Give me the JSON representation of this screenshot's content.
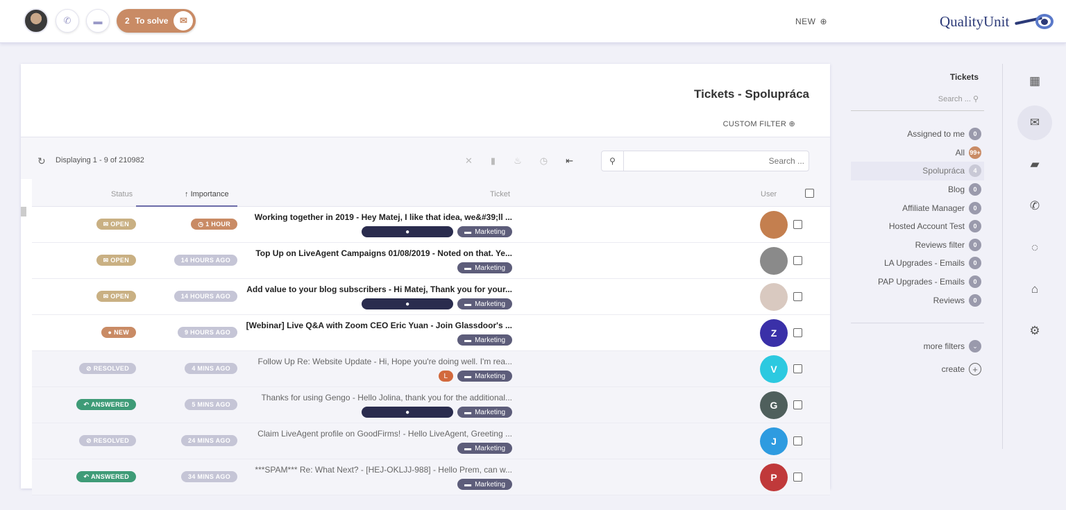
{
  "header": {
    "to_solve_label": "To solve",
    "to_solve_count": "2",
    "new_label": "NEW",
    "logo_text": "QualityUnit"
  },
  "main": {
    "title": "Tickets - Spolupráca",
    "custom_filter": "CUSTOM FILTER",
    "displaying": "Displaying 1 - 9 of 210982",
    "search_placeholder": "Search ...",
    "columns": {
      "user": "User",
      "ticket": "Ticket",
      "importance": "Importance",
      "status": "Status"
    },
    "rows": [
      {
        "subject": "Working together in 2019 - Hey Matej, I like that idea, we&#39;ll ...",
        "tags": [
          "Marketing"
        ],
        "dark_tag": true,
        "importance": "1 HOUR",
        "status": "OPEN",
        "read": false,
        "avatar_letter": "",
        "avatar_color": "#c47f4f"
      },
      {
        "subject": "Top Up on LiveAgent Campaigns 01/08/2019 - Noted on that. Ye...",
        "tags": [
          "Marketing"
        ],
        "dark_tag": false,
        "importance": "14 HOURS AGO",
        "status": "OPEN",
        "read": false,
        "avatar_letter": "",
        "avatar_color": "#8a8a8a"
      },
      {
        "subject": "Add value to your blog subscribers - Hi Matej, Thank you for your...",
        "tags": [
          "Marketing"
        ],
        "dark_tag": true,
        "importance": "14 HOURS AGO",
        "status": "OPEN",
        "read": false,
        "avatar_letter": "",
        "avatar_color": "#d9c9c0"
      },
      {
        "subject": "[Webinar] Live Q&A with Zoom CEO Eric Yuan - Join Glassdoor's ...",
        "tags": [
          "Marketing"
        ],
        "dark_tag": false,
        "importance": "9 HOURS AGO",
        "status": "NEW",
        "read": false,
        "avatar_letter": "Z",
        "avatar_color": "#3a30a8"
      },
      {
        "subject": "Follow Up Re: Website Update - Hi, Hope you're doing well. I'm rea...",
        "tags": [
          "Marketing"
        ],
        "dark_tag": false,
        "orange_tag": "L",
        "importance": "4 MINS AGO",
        "status": "RESOLVED",
        "read": true,
        "avatar_letter": "V",
        "avatar_color": "#2cc9e0"
      },
      {
        "subject": "Thanks for using Gengo - Hello Jolina, thank you for the additional...",
        "tags": [
          "Marketing"
        ],
        "dark_tag": true,
        "importance": "5 MINS AGO",
        "status": "ANSWERED",
        "read": true,
        "avatar_letter": "G",
        "avatar_color": "#4f5f5c"
      },
      {
        "subject": "Claim LiveAgent profile on GoodFirms! - Hello LiveAgent, Greeting ...",
        "tags": [
          "Marketing"
        ],
        "dark_tag": false,
        "importance": "24 MINS AGO",
        "status": "RESOLVED",
        "read": true,
        "avatar_letter": "J",
        "avatar_color": "#2e9be0"
      },
      {
        "subject": "***SPAM*** Re: What Next? - [HEJ-OKLJJ-988] - Hello Prem, can w...",
        "tags": [
          "Marketing"
        ],
        "dark_tag": false,
        "importance": "34 MINS AGO",
        "status": "ANSWERED",
        "read": true,
        "avatar_letter": "P",
        "avatar_color": "#c0393a"
      }
    ]
  },
  "status_colors": {
    "OPEN": "#c9b083",
    "NEW": "#c98b65",
    "RESOLVED": "#c5c5d6",
    "ANSWERED": "#3e9b77"
  },
  "importance_colors": {
    "hot": "#c98b65",
    "normal": "#c5c5d6"
  },
  "sidebar": {
    "title": "Tickets",
    "search_placeholder": "Search ...",
    "items": [
      {
        "label": "Assigned to me",
        "count": "0"
      },
      {
        "label": "All",
        "count": "99+"
      },
      {
        "label": "Spolupráca",
        "count": "4"
      },
      {
        "label": "Blog",
        "count": "0"
      },
      {
        "label": "Affiliate Manager",
        "count": "0"
      },
      {
        "label": "Hosted Account Test",
        "count": "0"
      },
      {
        "label": "Reviews filter",
        "count": "0"
      },
      {
        "label": "LA Upgrades - Emails",
        "count": "0"
      },
      {
        "label": "PAP Upgrades - Emails",
        "count": "0"
      },
      {
        "label": "Reviews",
        "count": "0"
      }
    ],
    "more_filters": "more filters",
    "create": "create"
  },
  "rail_icons": [
    "dashboard-icon",
    "mail-icon",
    "chat-icon",
    "phone-icon",
    "circle-icon",
    "bank-icon",
    "gear-icon"
  ]
}
